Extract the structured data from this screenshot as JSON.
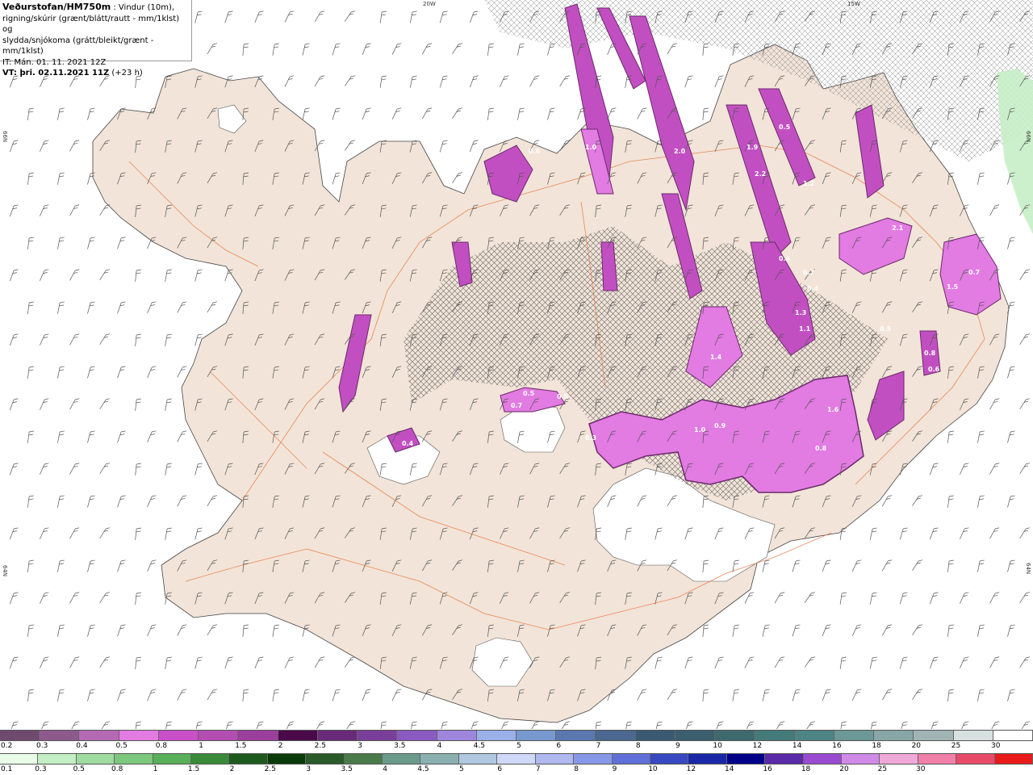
{
  "header": {
    "title": "Veðurstofan/HM750m",
    "title_suffix": " : Vindur (10m),",
    "line2": "rigning/skúrir (grænt/blátt/rautt - mm/1klst) og",
    "line3": "slydda/snjókoma (grátt/bleikt/grænt - mm/1klst)",
    "line4": "IT: Mán. 01. 11. 2021 12Z",
    "vt_label": "VT:",
    "vt_value": " þri. 02.11.2021 11Z",
    "vt_suffix": " (+23 h)"
  },
  "coords": {
    "lon_20w": "20W",
    "lon_15w": "15W",
    "lat_66n_left": "66N",
    "lat_66n_right": "66N",
    "lat_64n_left": "64N",
    "lat_64n_right": "64N"
  },
  "map_labels": [
    "0.5",
    "0.6",
    "1.0",
    "2.0",
    "1.9",
    "2.2",
    "0.7",
    "0.4",
    "1.3",
    "1.1",
    "0.6",
    "0.9",
    "1.0",
    "0.8",
    "1.4",
    "0.8",
    "0.5",
    "0.6",
    "0.4",
    "0.3",
    "0.7",
    "1.5",
    "0.7",
    "0.5",
    "0.5",
    "2.1",
    "1.2",
    "1.6"
  ],
  "legend_snow": {
    "colors": [
      "#6e4a6e",
      "#8e5a8e",
      "#b36ab3",
      "#e27be2",
      "#c94fc9",
      "#b24db2",
      "#9c3e9c",
      "#4a0a4a",
      "#6a2a7a",
      "#7a3f9a",
      "#8a5ac0",
      "#9e86dc",
      "#9ab0e8",
      "#7898d0",
      "#5a78b0",
      "#4a6890",
      "#3a5a74",
      "#3a5e6e",
      "#3e6a6e",
      "#447a7a",
      "#4e8484",
      "#6c9898",
      "#88a6a6",
      "#a0b4b4",
      "#d8e0e0",
      "#ffffff"
    ],
    "ticks": [
      "0.2",
      "0.3",
      "0.4",
      "0.5",
      "0.8",
      "1",
      "1.5",
      "2",
      "2.5",
      "3",
      "3.5",
      "4",
      "4.5",
      "5",
      "6",
      "7",
      "8",
      "9",
      "10",
      "12",
      "14",
      "16",
      "18",
      "20",
      "25",
      "30"
    ]
  },
  "legend_rain": {
    "colors": [
      "#e8fce8",
      "#c4eec4",
      "#a0dca0",
      "#7cc87c",
      "#58b058",
      "#3a8a3a",
      "#1e5a1e",
      "#0a3a0a",
      "#2a5a2a",
      "#4a7a4a",
      "#6a9a8a",
      "#8ab0b0",
      "#b0c8e0",
      "#d0d8f8",
      "#b0b8f0",
      "#8898e8",
      "#6070d8",
      "#3848c0",
      "#1a28a8",
      "#000088",
      "#5a2aa8",
      "#9a4ad0",
      "#d08ae8",
      "#f0a8d8",
      "#f080a8",
      "#e84a6a",
      "#e81a1a"
    ],
    "ticks": [
      "0.1",
      "0.3",
      "0.5",
      "0.8",
      "1",
      "1.5",
      "2",
      "2.5",
      "3",
      "3.5",
      "4",
      "4.5",
      "5",
      "6",
      "7",
      "8",
      "9",
      "10",
      "12",
      "14",
      "16",
      "18",
      "20",
      "25",
      "30"
    ]
  }
}
